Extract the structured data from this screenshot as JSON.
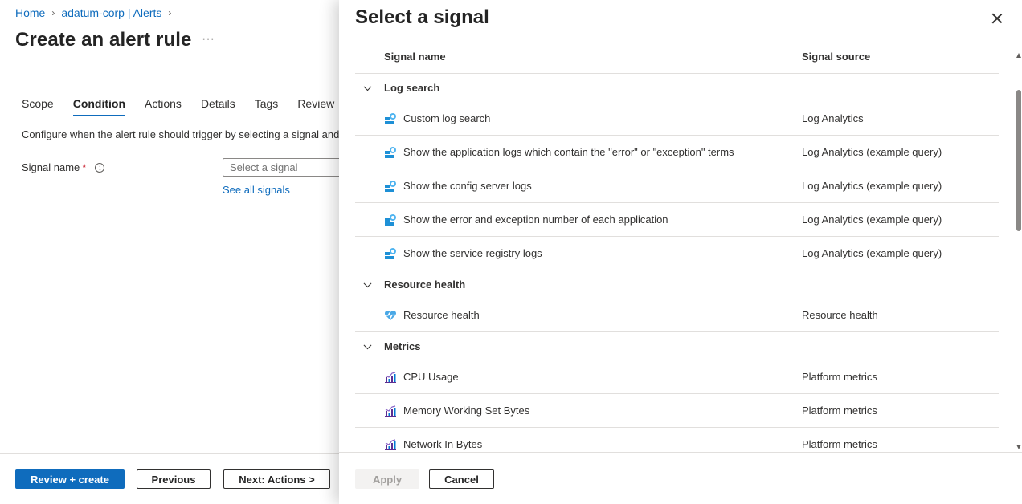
{
  "breadcrumb": {
    "items": [
      "Home",
      "adatum-corp | Alerts"
    ]
  },
  "page": {
    "title": "Create an alert rule",
    "more_label": "···"
  },
  "tabs": [
    {
      "label": "Scope"
    },
    {
      "label": "Condition",
      "active": true
    },
    {
      "label": "Actions"
    },
    {
      "label": "Details"
    },
    {
      "label": "Tags"
    },
    {
      "label": "Review +"
    }
  ],
  "condition": {
    "description": "Configure when the alert rule should trigger by selecting a signal and",
    "signal_label": "Signal name",
    "required_mark": "*",
    "info_icon": "i",
    "signal_placeholder": "Select a signal",
    "see_all": "See all signals"
  },
  "footer": {
    "review_create": "Review + create",
    "previous": "Previous",
    "next": "Next: Actions >"
  },
  "panel": {
    "title": "Select a signal",
    "columns": {
      "name": "Signal name",
      "source": "Signal source"
    },
    "groups": [
      {
        "label": "Log search",
        "icon": "log-search-icon",
        "items": [
          {
            "name": "Custom log search",
            "source": "Log Analytics"
          },
          {
            "name": "Show the application logs which contain the \"error\" or \"exception\" terms",
            "source": "Log Analytics (example query)"
          },
          {
            "name": "Show the config server logs",
            "source": "Log Analytics (example query)"
          },
          {
            "name": "Show the error and exception number of each application",
            "source": "Log Analytics (example query)"
          },
          {
            "name": "Show the service registry logs",
            "source": "Log Analytics (example query)"
          }
        ]
      },
      {
        "label": "Resource health",
        "icon": "heart-pulse-icon",
        "items": [
          {
            "name": "Resource health",
            "source": "Resource health"
          }
        ]
      },
      {
        "label": "Metrics",
        "icon": "metrics-chart-icon",
        "items": [
          {
            "name": "CPU Usage",
            "source": "Platform metrics"
          },
          {
            "name": "Memory Working Set Bytes",
            "source": "Platform metrics"
          },
          {
            "name": "Network In Bytes",
            "source": "Platform metrics"
          }
        ]
      }
    ],
    "apply": "Apply",
    "cancel": "Cancel"
  },
  "colors": {
    "accent": "#0f6cbd",
    "required": "#c50f1f",
    "log_icon": "#1e90d6",
    "heart_icon": "#4aa8e6",
    "metrics_icon": "#5c2d91"
  }
}
